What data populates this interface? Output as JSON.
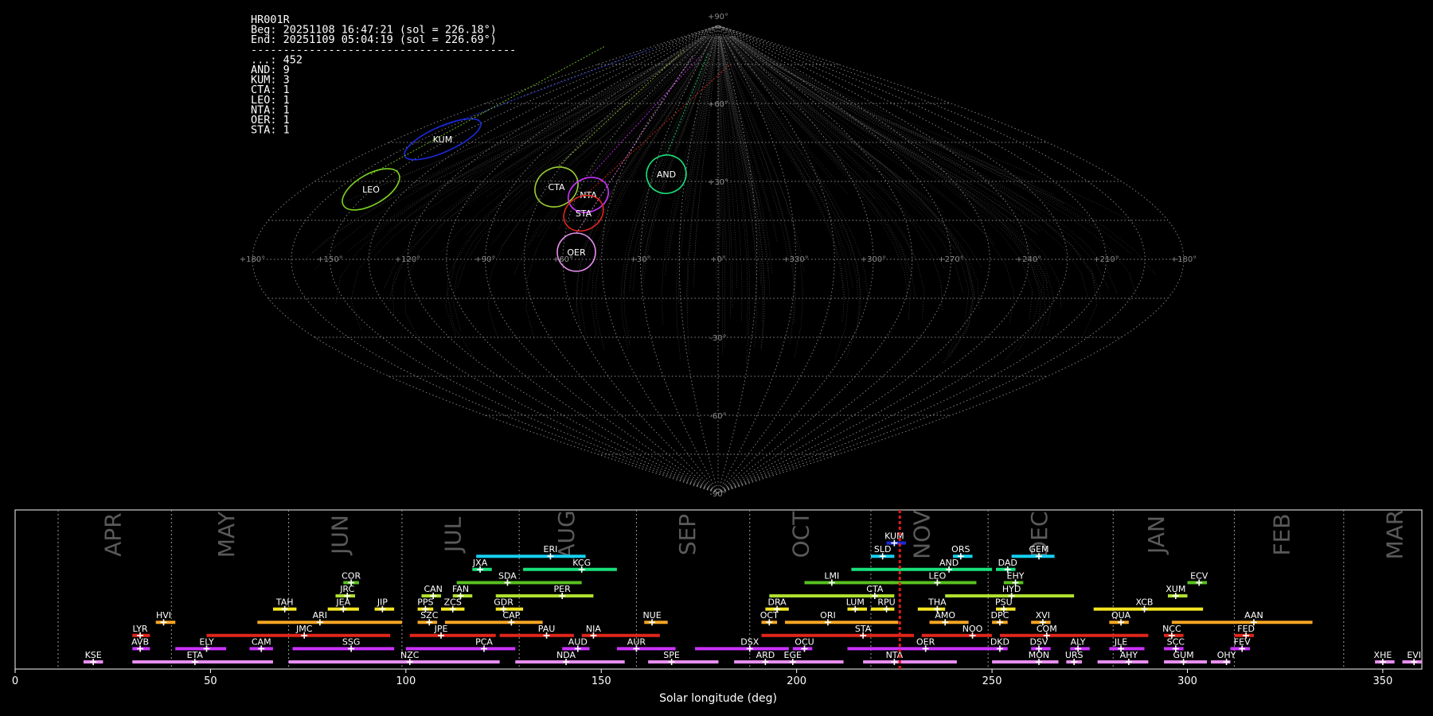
{
  "info": {
    "lines": [
      "HR001R",
      "Beg: 20251108 16:47:21 (sol = 226.18°)",
      "End: 20251109 05:04:19 (sol = 226.69°)",
      "-----------------------------------------",
      "...: 452",
      "AND: 9",
      "KUM: 3",
      "CTA: 1",
      "LEO: 1",
      "NTA: 1",
      "OER: 1",
      "STA: 1"
    ]
  },
  "chart_data": [
    {
      "type": "scatter",
      "projection": "sinusoidal",
      "lon_labels": [
        "+180°",
        "+150°",
        "+120°",
        "+90°",
        "+60°",
        "+30°",
        "+0°",
        "+330°",
        "+300°",
        "+270°",
        "+240°",
        "+210°",
        "+180°"
      ],
      "lat_labels": [
        "+90°",
        "+60°",
        "+30°",
        "-30°",
        "-60°",
        "-90°"
      ],
      "grid": true,
      "radiants": [
        {
          "label": "KUM",
          "color": "#1a2ad8"
        },
        {
          "label": "LEO",
          "color": "#7ed321"
        },
        {
          "label": "CTA",
          "color": "#9acd32"
        },
        {
          "label": "NTA",
          "color": "#cc33ff"
        },
        {
          "label": "STA",
          "color": "#e0261b"
        },
        {
          "label": "AND",
          "color": "#19e07a"
        },
        {
          "label": "OER",
          "color": "#e88ef0"
        }
      ]
    },
    {
      "type": "bar",
      "orientation": "horizontal",
      "xlabel": "Solar longitude (deg)",
      "xlim": [
        0,
        360
      ],
      "xticks": [
        "0",
        "50",
        "100",
        "150",
        "200",
        "250",
        "300",
        "350"
      ],
      "months": [
        {
          "label": "APR",
          "sol": 25
        },
        {
          "label": "MAY",
          "sol": 54
        },
        {
          "label": "JUN",
          "sol": 83
        },
        {
          "label": "JUL",
          "sol": 112
        },
        {
          "label": "AUG",
          "sol": 141
        },
        {
          "label": "SEP",
          "sol": 172
        },
        {
          "label": "OCT",
          "sol": 201
        },
        {
          "label": "NOV",
          "sol": 232
        },
        {
          "label": "DEC",
          "sol": 262
        },
        {
          "label": "JAN",
          "sol": 292
        },
        {
          "label": "FEB",
          "sol": 324
        },
        {
          "label": "MAR",
          "sol": 353
        }
      ],
      "month_dividers": [
        11,
        40,
        70,
        99,
        129,
        159,
        188,
        219,
        249,
        281,
        312,
        340
      ],
      "current_sol": 226.4,
      "showers": [
        {
          "label": "KSE",
          "start": 17.5,
          "end": 22.5,
          "peak": 20,
          "row": 0,
          "color": "#e88ef0"
        },
        {
          "label": "ETA",
          "start": 30,
          "end": 66,
          "peak": 46,
          "row": 0,
          "color": "#e88ef0"
        },
        {
          "label": "NZC",
          "start": 70,
          "end": 124,
          "peak": 101,
          "row": 0,
          "color": "#e88ef0"
        },
        {
          "label": "NDA",
          "start": 128,
          "end": 156,
          "peak": 141,
          "row": 0,
          "color": "#e88ef0"
        },
        {
          "label": "SPE",
          "start": 162,
          "end": 180,
          "peak": 168,
          "row": 0,
          "color": "#e88ef0"
        },
        {
          "label": "ARD",
          "start": 184,
          "end": 196,
          "peak": 192,
          "row": 0,
          "color": "#e88ef0"
        },
        {
          "label": "EGE",
          "start": 196,
          "end": 212,
          "peak": 199,
          "row": 0,
          "color": "#e88ef0"
        },
        {
          "label": "NTA",
          "start": 217,
          "end": 241,
          "peak": 225,
          "row": 0,
          "color": "#e88ef0"
        },
        {
          "label": "MON",
          "start": 250,
          "end": 267,
          "peak": 262,
          "row": 0,
          "color": "#e88ef0"
        },
        {
          "label": "URS",
          "start": 269,
          "end": 273,
          "peak": 271,
          "row": 0,
          "color": "#e88ef0"
        },
        {
          "label": "AHY",
          "start": 277,
          "end": 290,
          "peak": 285,
          "row": 0,
          "color": "#e88ef0"
        },
        {
          "label": "GUM",
          "start": 294,
          "end": 305,
          "peak": 299,
          "row": 0,
          "color": "#e88ef0"
        },
        {
          "label": "OHY",
          "start": 306,
          "end": 311,
          "peak": 310,
          "row": 0,
          "color": "#e88ef0"
        },
        {
          "label": "XHE",
          "start": 348,
          "end": 353,
          "peak": 350,
          "row": 0,
          "color": "#e88ef0"
        },
        {
          "label": "EVI",
          "start": 355,
          "end": 360,
          "peak": 358,
          "row": 0,
          "color": "#e88ef0"
        },
        {
          "label": "AVB",
          "start": 30,
          "end": 34.5,
          "peak": 32,
          "row": 1,
          "color": "#cc33ff"
        },
        {
          "label": "ELY",
          "start": 41,
          "end": 54,
          "peak": 49,
          "row": 1,
          "color": "#cc33ff"
        },
        {
          "label": "CAM",
          "start": 60,
          "end": 66,
          "peak": 63,
          "row": 1,
          "color": "#cc33ff"
        },
        {
          "label": "SSG",
          "start": 71,
          "end": 97,
          "peak": 86,
          "row": 1,
          "color": "#cc33ff"
        },
        {
          "label": "PCA",
          "start": 100,
          "end": 128,
          "peak": 120,
          "row": 1,
          "color": "#cc33ff"
        },
        {
          "label": "AUD",
          "start": 140,
          "end": 147,
          "peak": 144,
          "row": 1,
          "color": "#cc33ff"
        },
        {
          "label": "AUR",
          "start": 154,
          "end": 169,
          "peak": 159,
          "row": 1,
          "color": "#cc33ff"
        },
        {
          "label": "DSX",
          "start": 174,
          "end": 198,
          "peak": 188,
          "row": 1,
          "color": "#cc33ff"
        },
        {
          "label": "OCU",
          "start": 199,
          "end": 204,
          "peak": 202,
          "row": 1,
          "color": "#cc33ff"
        },
        {
          "label": "OER",
          "start": 213,
          "end": 250,
          "peak": 233,
          "row": 1,
          "color": "#cc33ff"
        },
        {
          "label": "DKD",
          "start": 250,
          "end": 254,
          "peak": 252,
          "row": 1,
          "color": "#cc33ff"
        },
        {
          "label": "DSV",
          "start": 260,
          "end": 265,
          "peak": 262,
          "row": 1,
          "color": "#cc33ff"
        },
        {
          "label": "ALY",
          "start": 270,
          "end": 275,
          "peak": 272,
          "row": 1,
          "color": "#cc33ff"
        },
        {
          "label": "JLE",
          "start": 280,
          "end": 289,
          "peak": 283,
          "row": 1,
          "color": "#cc33ff"
        },
        {
          "label": "SCC",
          "start": 294,
          "end": 299,
          "peak": 297,
          "row": 1,
          "color": "#cc33ff"
        },
        {
          "label": "FEV",
          "start": 311,
          "end": 316,
          "peak": 314,
          "row": 1,
          "color": "#cc33ff"
        },
        {
          "label": "LYR",
          "start": 30,
          "end": 34.5,
          "peak": 32,
          "row": 2,
          "color": "#e0261b"
        },
        {
          "label": "JMC",
          "start": 49,
          "end": 96,
          "peak": 74,
          "row": 2,
          "color": "#e0261b"
        },
        {
          "label": "JPE",
          "start": 101,
          "end": 123,
          "peak": 109,
          "row": 2,
          "color": "#e0261b"
        },
        {
          "label": "PAU",
          "start": 124,
          "end": 143,
          "peak": 136,
          "row": 2,
          "color": "#e0261b"
        },
        {
          "label": "NIA",
          "start": 145,
          "end": 165,
          "peak": 148,
          "row": 2,
          "color": "#e0261b"
        },
        {
          "label": "STA",
          "start": 191,
          "end": 230,
          "peak": 217,
          "row": 2,
          "color": "#e0261b"
        },
        {
          "label": "NOO",
          "start": 232,
          "end": 250,
          "peak": 245,
          "row": 2,
          "color": "#e0261b"
        },
        {
          "label": "COM",
          "start": 252,
          "end": 290,
          "peak": 264,
          "row": 2,
          "color": "#e0261b"
        },
        {
          "label": "NCC",
          "start": 294,
          "end": 299,
          "peak": 296,
          "row": 2,
          "color": "#e0261b"
        },
        {
          "label": "FED",
          "start": 312,
          "end": 317,
          "peak": 315,
          "row": 2,
          "color": "#e0261b"
        },
        {
          "label": "HVI",
          "start": 36,
          "end": 41,
          "peak": 38,
          "row": 3,
          "color": "#f5a623"
        },
        {
          "label": "ARI",
          "start": 62,
          "end": 99,
          "peak": 78,
          "row": 3,
          "color": "#f5a623"
        },
        {
          "label": "SZC",
          "start": 103,
          "end": 108,
          "peak": 106,
          "row": 3,
          "color": "#f5a623"
        },
        {
          "label": "CAP",
          "start": 110,
          "end": 135,
          "peak": 127,
          "row": 3,
          "color": "#f5a623"
        },
        {
          "label": "NUE",
          "start": 161,
          "end": 167,
          "peak": 163,
          "row": 3,
          "color": "#f5a623"
        },
        {
          "label": "OCT",
          "start": 191,
          "end": 195,
          "peak": 193,
          "row": 3,
          "color": "#f5a623"
        },
        {
          "label": "ORI",
          "start": 197,
          "end": 226,
          "peak": 208,
          "row": 3,
          "color": "#f5a623"
        },
        {
          "label": "AMO",
          "start": 234,
          "end": 244,
          "peak": 238,
          "row": 3,
          "color": "#f5a623"
        },
        {
          "label": "DPC",
          "start": 250,
          "end": 254,
          "peak": 252,
          "row": 3,
          "color": "#f5a623"
        },
        {
          "label": "XVI",
          "start": 260,
          "end": 265,
          "peak": 263,
          "row": 3,
          "color": "#f5a623"
        },
        {
          "label": "QUA",
          "start": 280,
          "end": 285,
          "peak": 283,
          "row": 3,
          "color": "#f5a623"
        },
        {
          "label": "AAN",
          "start": 296,
          "end": 332,
          "peak": 317,
          "row": 3,
          "color": "#f5a623"
        },
        {
          "label": "TAH",
          "start": 66,
          "end": 72,
          "peak": 69,
          "row": 4,
          "color": "#f5e623"
        },
        {
          "label": "JEA",
          "start": 80,
          "end": 88,
          "peak": 84,
          "row": 4,
          "color": "#f5e623"
        },
        {
          "label": "JIP",
          "start": 92,
          "end": 97,
          "peak": 94,
          "row": 4,
          "color": "#f5e623"
        },
        {
          "label": "PPS",
          "start": 103,
          "end": 107,
          "peak": 105,
          "row": 4,
          "color": "#f5e623"
        },
        {
          "label": "ZCS",
          "start": 109,
          "end": 115,
          "peak": 112,
          "row": 4,
          "color": "#f5e623"
        },
        {
          "label": "GDR",
          "start": 123,
          "end": 130,
          "peak": 125,
          "row": 4,
          "color": "#f5e623"
        },
        {
          "label": "DRA",
          "start": 192,
          "end": 198,
          "peak": 195,
          "row": 4,
          "color": "#f5e623"
        },
        {
          "label": "LUM",
          "start": 213,
          "end": 218,
          "peak": 215,
          "row": 4,
          "color": "#f5e623"
        },
        {
          "label": "RPU",
          "start": 219,
          "end": 225,
          "peak": 223,
          "row": 4,
          "color": "#f5e623"
        },
        {
          "label": "THA",
          "start": 231,
          "end": 238,
          "peak": 236,
          "row": 4,
          "color": "#f5e623"
        },
        {
          "label": "PSU",
          "start": 251,
          "end": 256,
          "peak": 253,
          "row": 4,
          "color": "#f5e623"
        },
        {
          "label": "XCB",
          "start": 276,
          "end": 304,
          "peak": 289,
          "row": 4,
          "color": "#f5e623"
        },
        {
          "label": "JRC",
          "start": 82,
          "end": 87,
          "peak": 85,
          "row": 5,
          "color": "#b0e030"
        },
        {
          "label": "CAN",
          "start": 104,
          "end": 109,
          "peak": 107,
          "row": 5,
          "color": "#b0e030"
        },
        {
          "label": "FAN",
          "start": 112,
          "end": 117,
          "peak": 114,
          "row": 5,
          "color": "#b0e030"
        },
        {
          "label": "PER",
          "start": 123,
          "end": 148,
          "peak": 140,
          "row": 5,
          "color": "#b0e030"
        },
        {
          "label": "CTA",
          "start": 193,
          "end": 225,
          "peak": 220,
          "row": 5,
          "color": "#b0e030"
        },
        {
          "label": "HYD",
          "start": 238,
          "end": 271,
          "peak": 255,
          "row": 5,
          "color": "#b0e030"
        },
        {
          "label": "XUM",
          "start": 295,
          "end": 300,
          "peak": 297,
          "row": 5,
          "color": "#b0e030"
        },
        {
          "label": "COR",
          "start": 84,
          "end": 88,
          "peak": 86,
          "row": 6,
          "color": "#58c01e"
        },
        {
          "label": "SDA",
          "start": 113,
          "end": 145,
          "peak": 126,
          "row": 6,
          "color": "#58c01e"
        },
        {
          "label": "LMI",
          "start": 202,
          "end": 225,
          "peak": 209,
          "row": 6,
          "color": "#58c01e"
        },
        {
          "label": "LEO",
          "start": 224,
          "end": 246,
          "peak": 236,
          "row": 6,
          "color": "#58c01e"
        },
        {
          "label": "EHY",
          "start": 253,
          "end": 258,
          "peak": 256,
          "row": 6,
          "color": "#58c01e"
        },
        {
          "label": "ECV",
          "start": 300,
          "end": 305,
          "peak": 303,
          "row": 6,
          "color": "#58c01e"
        },
        {
          "label": "JXA",
          "start": 117,
          "end": 122,
          "peak": 119,
          "row": 7,
          "color": "#19e07a"
        },
        {
          "label": "KCG",
          "start": 130,
          "end": 154,
          "peak": 145,
          "row": 7,
          "color": "#19e07a"
        },
        {
          "label": "AND",
          "start": 214,
          "end": 250,
          "peak": 239,
          "row": 7,
          "color": "#19e07a"
        },
        {
          "label": "DAD",
          "start": 251,
          "end": 256,
          "peak": 254,
          "row": 7,
          "color": "#19e07a"
        },
        {
          "label": "ERI",
          "start": 118,
          "end": 146,
          "peak": 137,
          "row": 8,
          "color": "#16d0f0"
        },
        {
          "label": "SLD",
          "start": 219,
          "end": 225,
          "peak": 222,
          "row": 8,
          "color": "#16d0f0"
        },
        {
          "label": "ORS",
          "start": 240,
          "end": 245,
          "peak": 242,
          "row": 8,
          "color": "#16d0f0"
        },
        {
          "label": "GEM",
          "start": 255,
          "end": 266,
          "peak": 262,
          "row": 8,
          "color": "#16d0f0"
        },
        {
          "label": "KUM",
          "start": 223,
          "end": 228,
          "peak": 225,
          "row": 9,
          "color": "#1a2ad8"
        }
      ]
    }
  ]
}
